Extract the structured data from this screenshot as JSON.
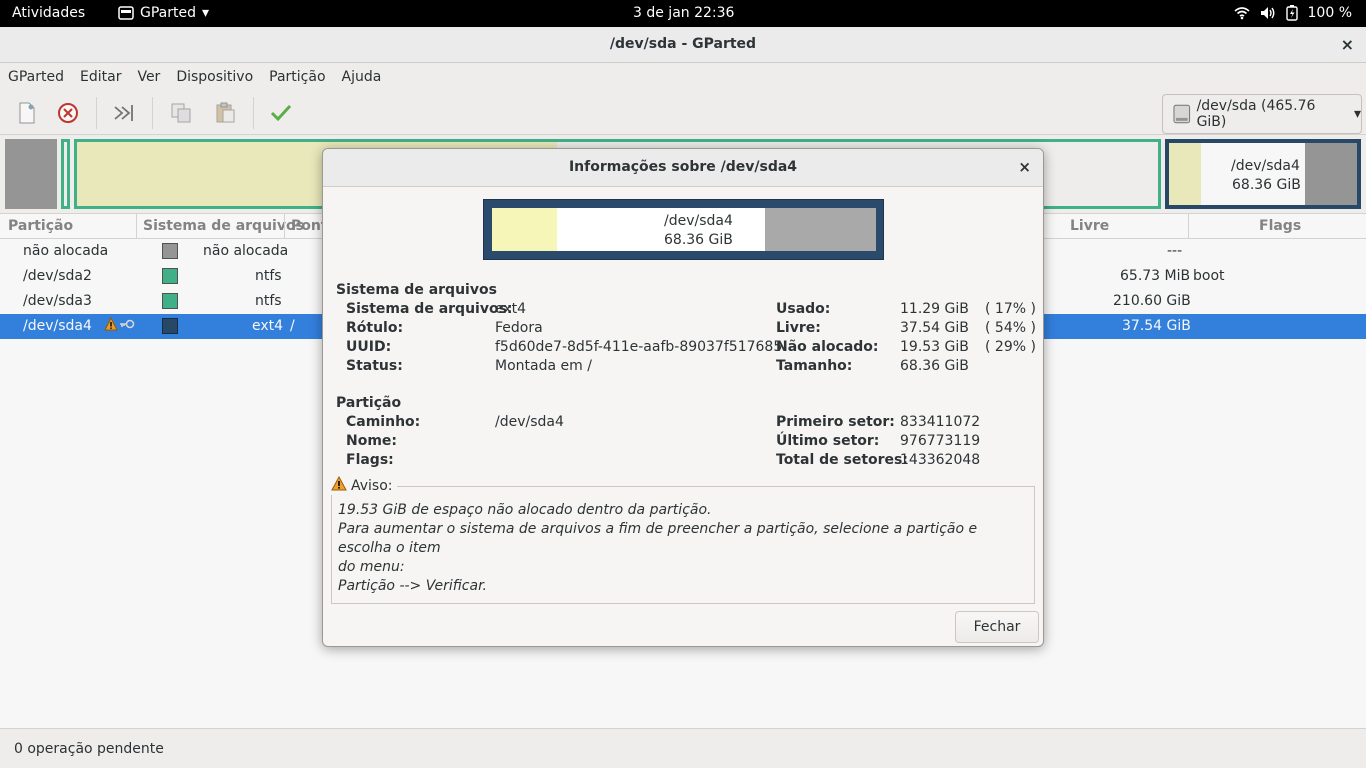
{
  "topbar": {
    "activities": "Atividades",
    "app_name": "GParted",
    "clock": "3 de jan  22:36",
    "battery": "100 %"
  },
  "window": {
    "title": "/dev/sda - GParted",
    "close": "×"
  },
  "menu": [
    "GParted",
    "Editar",
    "Ver",
    "Dispositivo",
    "Partição",
    "Ajuda"
  ],
  "toolbar": {
    "device": "/dev/sda (465.76 GiB)"
  },
  "diskmap": {
    "sel_label": "/dev/sda4",
    "sel_size": "68.36 GiB"
  },
  "table": {
    "headers": {
      "part": "Partição",
      "fs": "Sistema de arquivos",
      "mount": "Ponto de montagem",
      "free": "Livre",
      "flags": "Flags"
    },
    "rows": [
      {
        "part": "não alocada",
        "fs": "não alocada",
        "mount": "",
        "free": "---",
        "flags": "",
        "color": "#a9a9a9"
      },
      {
        "part": "/dev/sda2",
        "fs": "ntfs",
        "mount": "",
        "free": "65.73 MiB",
        "flags": "boot",
        "color": "#42b68d"
      },
      {
        "part": "/dev/sda3",
        "fs": "ntfs",
        "mount": "",
        "free": "210.60 GiB",
        "flags": "",
        "color": "#42b68d"
      },
      {
        "part": "/dev/sda4",
        "fs": "ext4",
        "mount": "/",
        "free": "37.54 GiB",
        "flags": "",
        "color": "#2a4b6b"
      }
    ]
  },
  "status": "0 operação pendente",
  "dialog": {
    "title": "Informações sobre /dev/sda4",
    "close": "×",
    "map_label": "/dev/sda4",
    "map_size": "68.36 GiB",
    "fs_section": "Sistema de arquivos",
    "fs_rows": [
      {
        "k": "Sistema de arquivos:",
        "v": "ext4"
      },
      {
        "k": "Rótulo:",
        "v": "Fedora"
      },
      {
        "k": "UUID:",
        "v": "f5d60de7-8d5f-411e-aafb-89037f517685"
      },
      {
        "k": "Status:",
        "v": "Montada em /"
      }
    ],
    "usage_rows": [
      {
        "k": "Usado:",
        "v": "11.29 GiB",
        "p": "( 17% )"
      },
      {
        "k": "Livre:",
        "v": "37.54 GiB",
        "p": "( 54% )"
      },
      {
        "k": "Não alocado:",
        "v": "19.53 GiB",
        "p": "( 29% )"
      },
      {
        "k": "Tamanho:",
        "v": "68.36 GiB",
        "p": ""
      }
    ],
    "part_section": "Partição",
    "part_rows": [
      {
        "k": "Caminho:",
        "v": "/dev/sda4"
      },
      {
        "k": "Nome:",
        "v": ""
      },
      {
        "k": "Flags:",
        "v": ""
      }
    ],
    "sector_rows": [
      {
        "k": "Primeiro setor:",
        "v": "833411072"
      },
      {
        "k": "Último setor:",
        "v": "976773119"
      },
      {
        "k": "Total de setores:",
        "v": "143362048"
      }
    ],
    "warning_title": "Aviso:",
    "warning_lines": [
      "19.53 GiB de espaço não alocado dentro da partição.",
      "Para aumentar o sistema de arquivos a fim de preencher a partição, selecione a partição e escolha o item",
      "do menu:",
      "Partição --> Verificar."
    ],
    "close_button": "Fechar",
    "used_fraction": 0.17,
    "free_fraction": 0.54,
    "unalloc_fraction": 0.29
  }
}
